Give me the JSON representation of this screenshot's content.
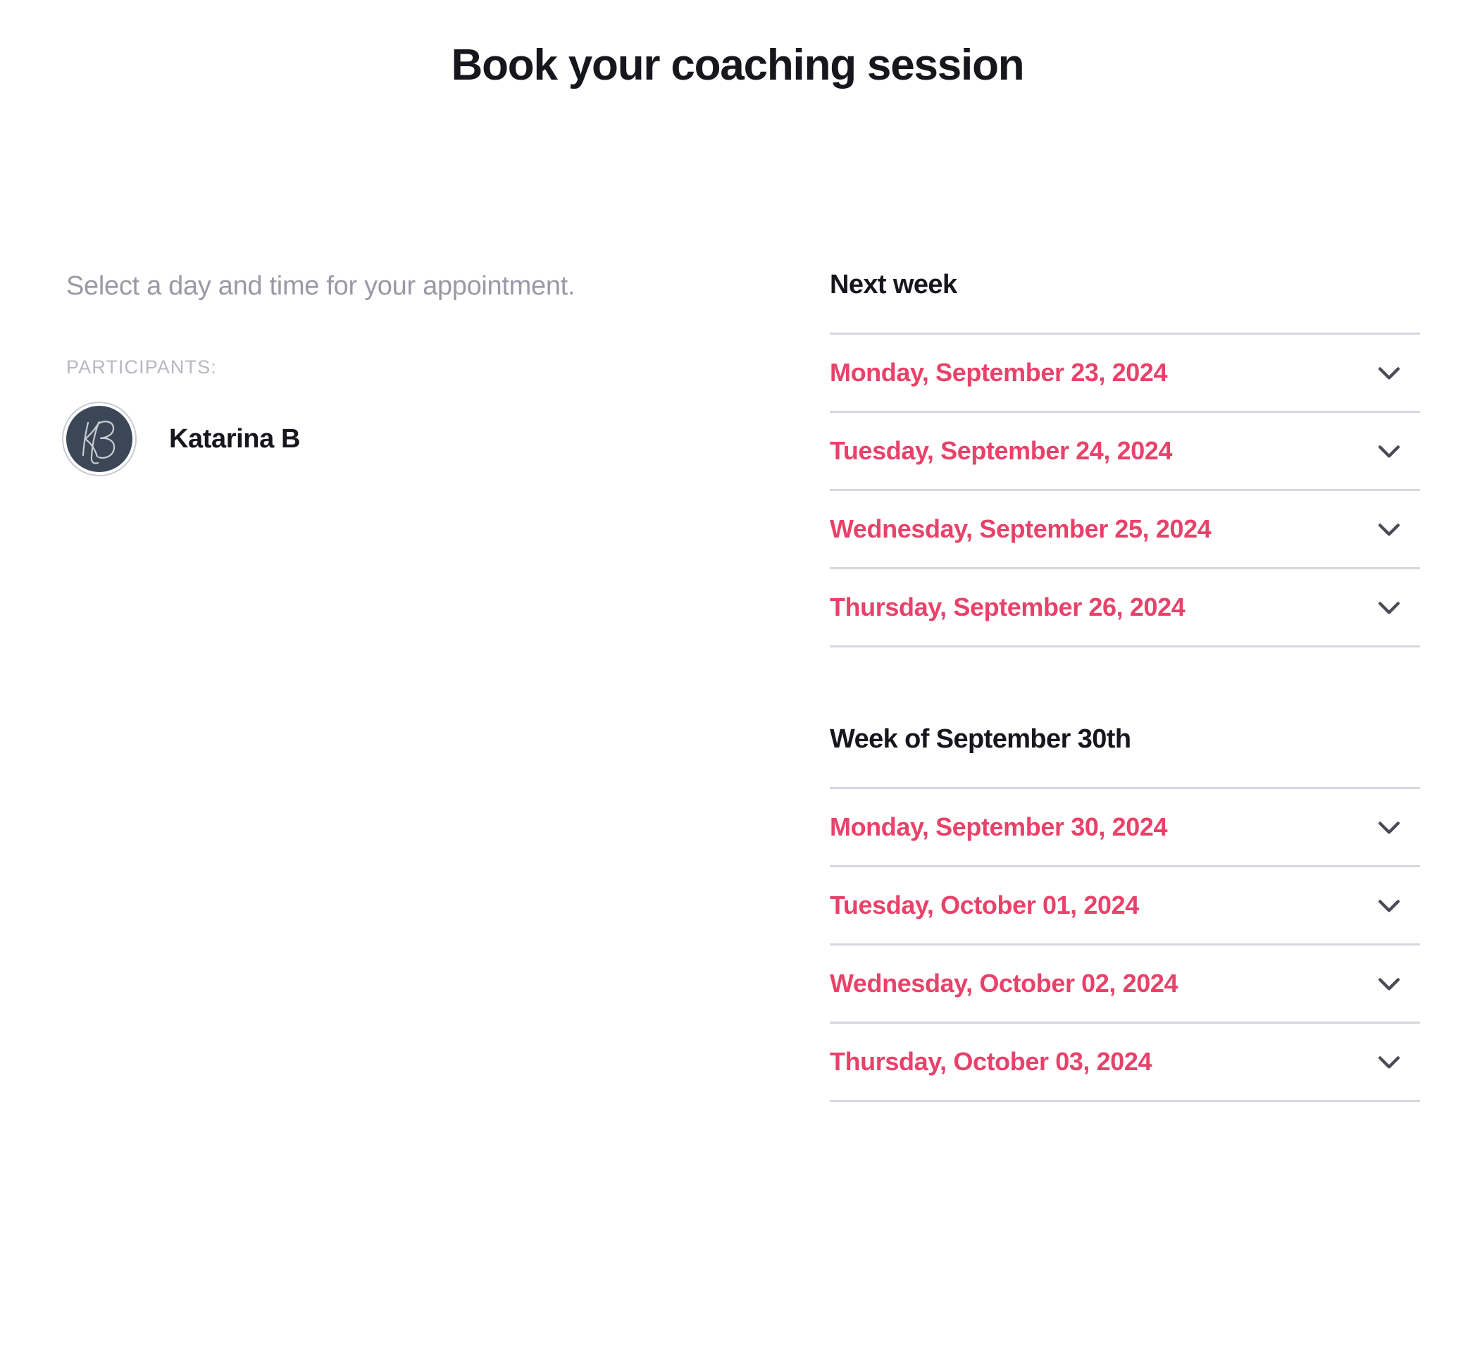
{
  "page": {
    "title": "Book your coaching session"
  },
  "left": {
    "instruction": "Select a day and time for your appointment.",
    "participants_label": "PARTICIPANTS:",
    "participants": [
      {
        "name": "Katarina B",
        "avatar_initials": "KB",
        "avatar_bg": "#3b4656",
        "avatar_ring": "#c9ccd4"
      }
    ]
  },
  "right": {
    "accent_color": "#e8426a",
    "divider_color": "#d7d7e1",
    "chevron_color": "#4b4b57",
    "weeks": [
      {
        "heading": "Next week",
        "days": [
          {
            "label": "Monday, September 23, 2024",
            "toggle_icon": "chevron-down-icon"
          },
          {
            "label": "Tuesday, September 24, 2024",
            "toggle_icon": "chevron-down-icon"
          },
          {
            "label": "Wednesday, September 25, 2024",
            "toggle_icon": "chevron-down-icon"
          },
          {
            "label": "Thursday, September 26, 2024",
            "toggle_icon": "chevron-down-icon"
          }
        ]
      },
      {
        "heading": "Week of September 30th",
        "days": [
          {
            "label": "Monday, September 30, 2024",
            "toggle_icon": "chevron-down-icon"
          },
          {
            "label": "Tuesday, October 01, 2024",
            "toggle_icon": "chevron-down-icon"
          },
          {
            "label": "Wednesday, October 02, 2024",
            "toggle_icon": "chevron-down-icon"
          },
          {
            "label": "Thursday, October 03, 2024",
            "toggle_icon": "chevron-down-icon"
          }
        ]
      }
    ]
  }
}
